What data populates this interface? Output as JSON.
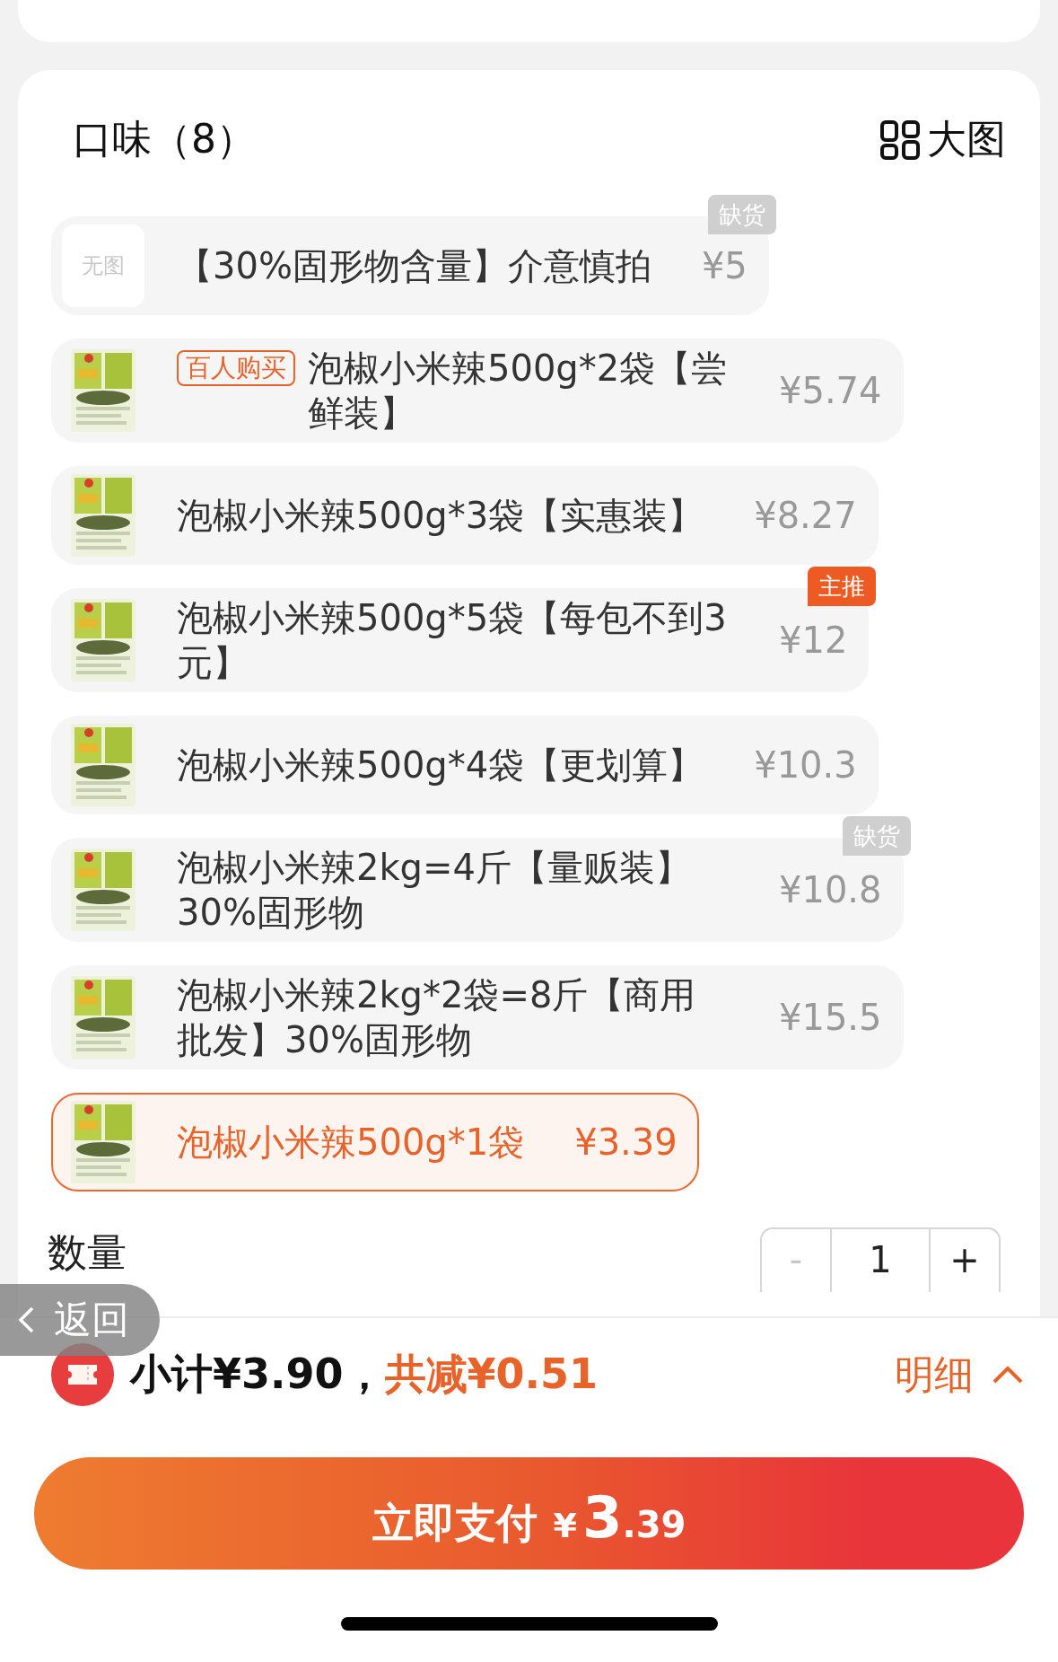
{
  "section": {
    "title": "口味（8）",
    "view_toggle": "大图"
  },
  "options": [
    {
      "thumbnail": {
        "kind": "placeholder",
        "text": "无图"
      },
      "label": "【30%固形物含量】介意慎拍",
      "price": "¥5",
      "badge": {
        "text": "缺货",
        "kind": "stock"
      },
      "selected": false
    },
    {
      "tag": "百人购买",
      "label": "泡椒小米辣500g*2袋【尝鲜装】",
      "price": "¥5.74",
      "selected": false
    },
    {
      "label": "泡椒小米辣500g*3袋【实惠装】",
      "price": "¥8.27",
      "selected": false
    },
    {
      "label": "泡椒小米辣500g*5袋【每包不到3元】",
      "price": "¥12",
      "badge": {
        "text": "主推",
        "kind": "promo"
      },
      "selected": false
    },
    {
      "label": "泡椒小米辣500g*4袋【更划算】",
      "price": "¥10.3",
      "selected": false
    },
    {
      "label": "泡椒小米辣2kg=4斤【量贩装】30%固形物",
      "price": "¥10.8",
      "badge": {
        "text": "缺货",
        "kind": "stock"
      },
      "selected": false
    },
    {
      "label": "泡椒小米辣2kg*2袋=8斤【商用批发】30%固形物",
      "price": "¥15.5",
      "selected": false
    },
    {
      "label": "泡椒小米辣500g*1袋",
      "price": "¥3.39",
      "selected": true
    }
  ],
  "quantity": {
    "label": "数量",
    "minus": "-",
    "value": "1",
    "plus": "+",
    "minus_disabled": true
  },
  "back": {
    "label": "返回"
  },
  "summary": {
    "subtotal": "小计¥3.90，",
    "discount": "共减¥0.51",
    "details": "明细"
  },
  "pay_button": {
    "label": "立即支付",
    "currency": "¥",
    "amount_integer": "3",
    "amount_decimal": ".39"
  }
}
